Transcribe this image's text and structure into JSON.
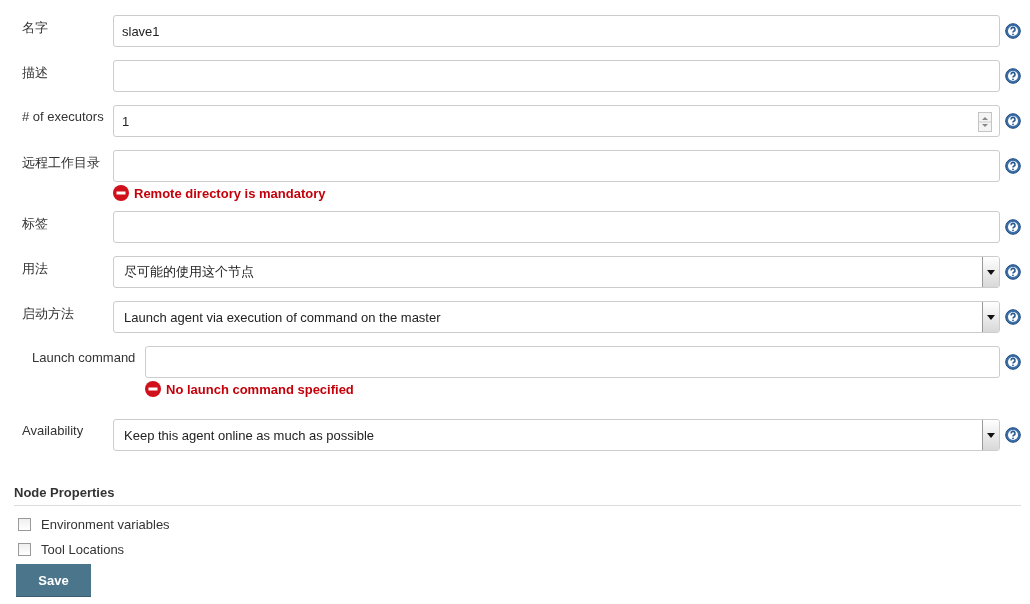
{
  "fields": [
    {
      "label": "名字",
      "kind": "text",
      "value": "slave1"
    },
    {
      "label": "描述",
      "kind": "text"
    },
    {
      "label": "# of executors",
      "kind": "number",
      "value": "1"
    },
    {
      "label": "远程工作目录",
      "kind": "text",
      "error": "Remote directory is mandatory"
    },
    {
      "label": "标签",
      "kind": "text"
    },
    {
      "label": "用法",
      "kind": "select",
      "value": "尽可能的使用这个节点"
    },
    {
      "label": "启动方法",
      "kind": "select",
      "value": "Launch agent via execution of command on the master",
      "children": [
        {
          "label": "Launch command",
          "kind": "text",
          "error": "No launch command specified"
        }
      ]
    },
    {
      "label": "Availability",
      "kind": "select",
      "value": "Keep this agent online as much as possible"
    }
  ],
  "node_properties": {
    "title": "Node Properties",
    "options": [
      {
        "label": "Environment variables",
        "checked": false
      },
      {
        "label": "Tool Locations",
        "checked": false
      }
    ]
  },
  "save_button": "Save"
}
